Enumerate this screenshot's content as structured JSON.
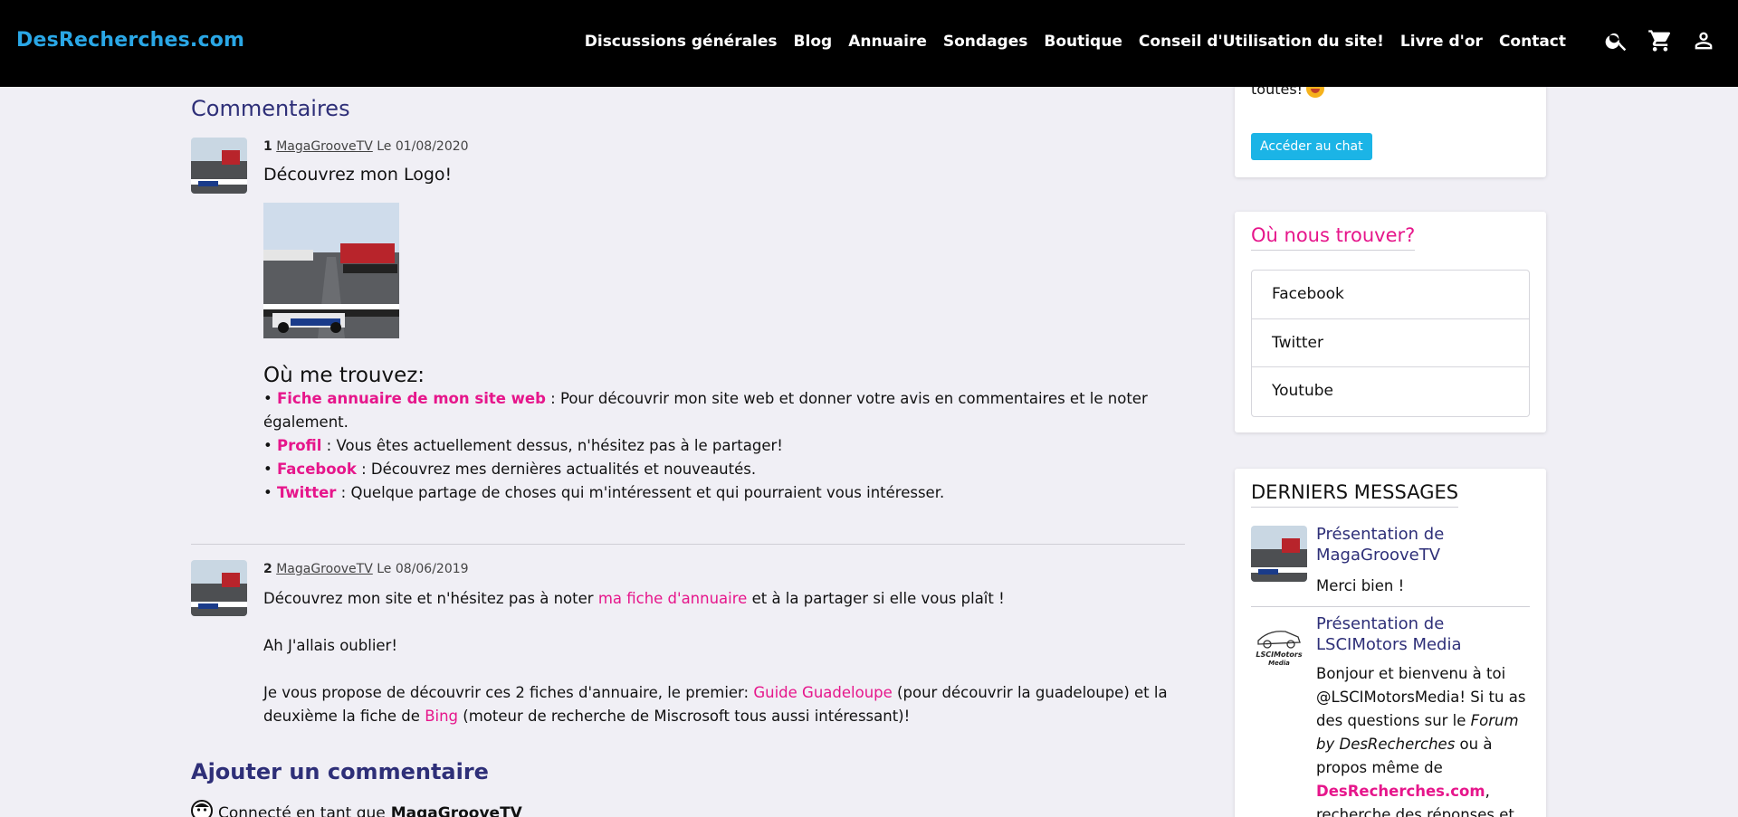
{
  "header": {
    "brand": "DesRecherches.com",
    "nav": [
      "Discussions générales",
      "Blog",
      "Annuaire",
      "Sondages",
      "Boutique",
      "Conseil d'Utilisation du site!",
      "Livre d'or",
      "Contact"
    ],
    "icons": [
      "search-icon",
      "cart-icon",
      "user-icon"
    ]
  },
  "main": {
    "comments_title": "Commentaires",
    "comment1": {
      "number": "1",
      "user": "MagaGrooveTV",
      "date": "Le 01/08/2020",
      "title": "Découvrez mon Logo!",
      "where_title": "Où me trouvez:",
      "items": [
        {
          "bullet": "•",
          "link": "Fiche annuaire de mon site web",
          "text": " : Pour découvrir mon site web et donner votre avis en commentaires et le noter également."
        },
        {
          "bullet": "•",
          "link": "Profil",
          "text": " : Vous êtes actuellement dessus, n'hésitez pas à le partager!"
        },
        {
          "bullet": "•",
          "link": "Facebook",
          "text": " : Découvrez mes dernières actualités et nouveautés."
        },
        {
          "bullet": "•",
          "link": "Twitter",
          "text": " : Quelque partage de choses qui m'intéressent et qui pourraient vous intéresser."
        }
      ]
    },
    "comment2": {
      "number": "2",
      "user": "MagaGrooveTV",
      "date": "Le 08/06/2019",
      "p1_before": "Découvrez mon site et n'hésitez pas à noter ",
      "p1_link": "ma fiche d'annuaire",
      "p1_after": " et à la partager si elle vous plaît !",
      "p2": "Ah J'allais oublier!",
      "p3_before": "Je vous propose de découvrir ces 2 fiches d'annuaire, le premier: ",
      "p3_link1": "Guide Guadeloupe",
      "p3_mid": " (pour découvrir la guadeloupe) et la deuxième la fiche de ",
      "p3_link2": "Bing",
      "p3_after": " (moteur de recherche de Miscrosoft tous aussi intéressant)!"
    },
    "add_title": "Ajouter un commentaire",
    "connected_prefix": "Connecté en tant que ",
    "connected_user": "MagaGrooveTV"
  },
  "sidebar": {
    "chat_tail": "toutes!",
    "chat_button": "Accéder au chat",
    "where_title": "Où nous trouver?",
    "social": [
      "Facebook",
      "Twitter",
      "Youtube"
    ],
    "messages_title": "DERNIERS MESSAGES",
    "messages": [
      {
        "title": "Présentation de MagaGrooveTV",
        "text": "Merci bien !"
      },
      {
        "title": "Présentation de LSCIMotors Media",
        "text_before": "Bonjour et bienvenu à toi @LSCIMotorsMedia! Si tu as des questions sur le ",
        "text_em": "Forum by DesRecherches",
        "text_mid": " ou à propos même de ",
        "text_link": "DesRecherches.com",
        "text_after": ", recherche des réponses et",
        "thumb_label1": "LSCIMotors",
        "thumb_label2": "Media"
      }
    ]
  },
  "colors": {
    "accent_pink": "#e6168b",
    "brand_blue": "#2aa7e6",
    "heading_navy": "#2e2f78",
    "button_cyan": "#1bb4e6"
  }
}
